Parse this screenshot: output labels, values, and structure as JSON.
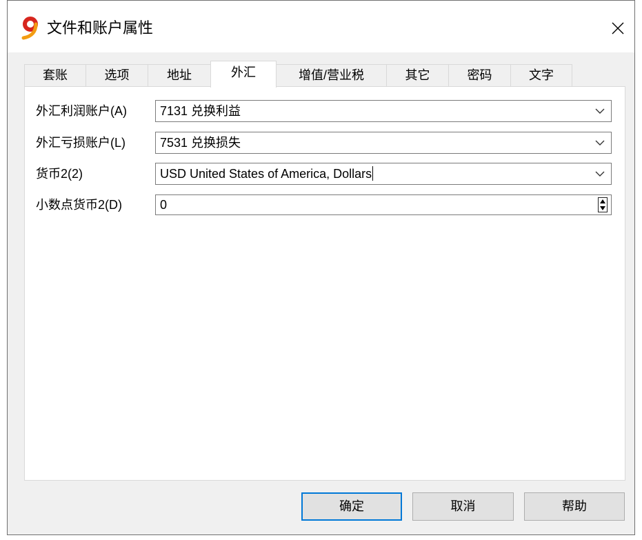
{
  "window": {
    "title": "文件和账户属性",
    "logo_text": "9",
    "app_icon": "app-logo-icon",
    "close_icon": "close-icon"
  },
  "tabs": [
    {
      "label": "套账",
      "selected": false
    },
    {
      "label": "选项",
      "selected": false
    },
    {
      "label": "地址",
      "selected": false
    },
    {
      "label": "外汇",
      "selected": true
    },
    {
      "label": "增值/营业税",
      "selected": false
    },
    {
      "label": "其它",
      "selected": false
    },
    {
      "label": "密码",
      "selected": false
    },
    {
      "label": "文字",
      "selected": false
    }
  ],
  "form": {
    "fx_profit_account": {
      "label": "外汇利润账户(A)",
      "value": "7131 兑换利益",
      "icon": "chevron-down-icon"
    },
    "fx_loss_account": {
      "label": "外汇亏损账户(L)",
      "value": "7531 兑换损失",
      "icon": "chevron-down-icon"
    },
    "currency2": {
      "label": "货币2(2)",
      "value": "USD United States of America, Dollars",
      "icon": "chevron-down-icon"
    },
    "currency2_decimals": {
      "label": "小数点货币2(D)",
      "value": "0",
      "icon": "spinner-icon"
    }
  },
  "buttons": {
    "ok": {
      "label": "确定",
      "default": true
    },
    "cancel": {
      "label": "取消",
      "default": false
    },
    "help": {
      "label": "帮助",
      "default": false
    }
  },
  "colors": {
    "accent": "#0078d7",
    "dialog_bg": "#f0f0f0",
    "logo_red": "#d7261e",
    "logo_orange": "#f39c12"
  }
}
